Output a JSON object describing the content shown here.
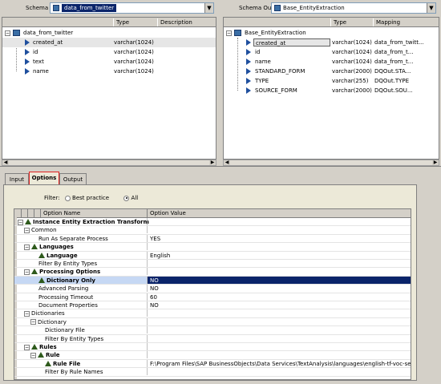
{
  "schema_in": {
    "label": "Schema In:",
    "value": "data_from_twitter",
    "columns": [
      "",
      "Type",
      "Description"
    ],
    "root": "data_from_twitter",
    "rows": [
      {
        "name": "created_at",
        "type": "varchar(1024)",
        "desc": ""
      },
      {
        "name": "id",
        "type": "varchar(1024)",
        "desc": ""
      },
      {
        "name": "text",
        "type": "varchar(1024)",
        "desc": ""
      },
      {
        "name": "name",
        "type": "varchar(1024)",
        "desc": ""
      }
    ]
  },
  "schema_out": {
    "label": "Schema Out:",
    "value": "Base_EntityExtraction",
    "columns": [
      "",
      "Type",
      "Mapping"
    ],
    "root": "Base_EntityExtraction",
    "rows": [
      {
        "name": "created_at",
        "type": "varchar(1024)",
        "mapping": "data_from_twitt..."
      },
      {
        "name": "id",
        "type": "varchar(1024)",
        "mapping": "data_from_t..."
      },
      {
        "name": "name",
        "type": "varchar(1024)",
        "mapping": "data_from_t..."
      },
      {
        "name": "STANDARD_FORM",
        "type": "varchar(2000)",
        "mapping": "DQOut.STA..."
      },
      {
        "name": "TYPE",
        "type": "varchar(255)",
        "mapping": "DQOut.TYPE"
      },
      {
        "name": "SOURCE_FORM",
        "type": "varchar(2000)",
        "mapping": "DQOut.SOU..."
      }
    ]
  },
  "tabs": [
    {
      "label": "Input"
    },
    {
      "label": "Options"
    },
    {
      "label": "Output"
    }
  ],
  "filter": {
    "label": "Filter:",
    "options": [
      "Best practice",
      "All"
    ],
    "selected": "All"
  },
  "options_grid": {
    "col_name": "Option Name",
    "col_value": "Option Value",
    "rows": [
      {
        "name": "Instance Entity Extraction Transform",
        "value": "",
        "level": 0,
        "bold": true,
        "expander": "-",
        "tri": true
      },
      {
        "name": "Common",
        "value": "",
        "level": 1,
        "bold": false,
        "expander": "-",
        "tri": false
      },
      {
        "name": "Run As Separate Process",
        "value": "YES",
        "level": 2,
        "bold": false,
        "expander": "",
        "tri": false
      },
      {
        "name": "Languages",
        "value": "",
        "level": 1,
        "bold": true,
        "expander": "-",
        "tri": true
      },
      {
        "name": "Language",
        "value": "English",
        "level": 2,
        "bold": true,
        "expander": "",
        "tri": true
      },
      {
        "name": "Filter By Entity Types",
        "value": "",
        "level": 2,
        "bold": false,
        "expander": "",
        "tri": false
      },
      {
        "name": "Processing Options",
        "value": "",
        "level": 1,
        "bold": true,
        "expander": "-",
        "tri": true
      },
      {
        "name": "Dictionary Only",
        "value": "NO",
        "level": 2,
        "bold": true,
        "expander": "",
        "tri": true,
        "selected": true
      },
      {
        "name": "Advanced Parsing",
        "value": "NO",
        "level": 2,
        "bold": false,
        "expander": "",
        "tri": false
      },
      {
        "name": "Processing Timeout",
        "value": "60",
        "level": 2,
        "bold": false,
        "expander": "",
        "tri": false
      },
      {
        "name": "Document Properties",
        "value": "NO",
        "level": 2,
        "bold": false,
        "expander": "",
        "tri": false
      },
      {
        "name": "Dictionaries",
        "value": "",
        "level": 1,
        "bold": false,
        "expander": "-",
        "tri": false
      },
      {
        "name": "Dictionary",
        "value": "",
        "level": 2,
        "bold": false,
        "expander": "-",
        "tri": false
      },
      {
        "name": "Dictionary File",
        "value": "",
        "level": 3,
        "bold": false,
        "expander": "",
        "tri": false
      },
      {
        "name": "Filter By Entity Types",
        "value": "",
        "level": 3,
        "bold": false,
        "expander": "",
        "tri": false
      },
      {
        "name": "Rules",
        "value": "",
        "level": 1,
        "bold": true,
        "expander": "-",
        "tri": true
      },
      {
        "name": "Rule",
        "value": "",
        "level": 2,
        "bold": true,
        "expander": "-",
        "tri": true
      },
      {
        "name": "Rule File",
        "value": "F:\\Program Files\\SAP BusinessObjects\\Data Services\\TextAnalysis\\languages\\english-tf-voc-sentime...",
        "level": 3,
        "bold": true,
        "expander": "",
        "tri": true
      },
      {
        "name": "Filter By Rule Names",
        "value": "",
        "level": 3,
        "bold": false,
        "expander": "",
        "tri": false
      }
    ]
  }
}
